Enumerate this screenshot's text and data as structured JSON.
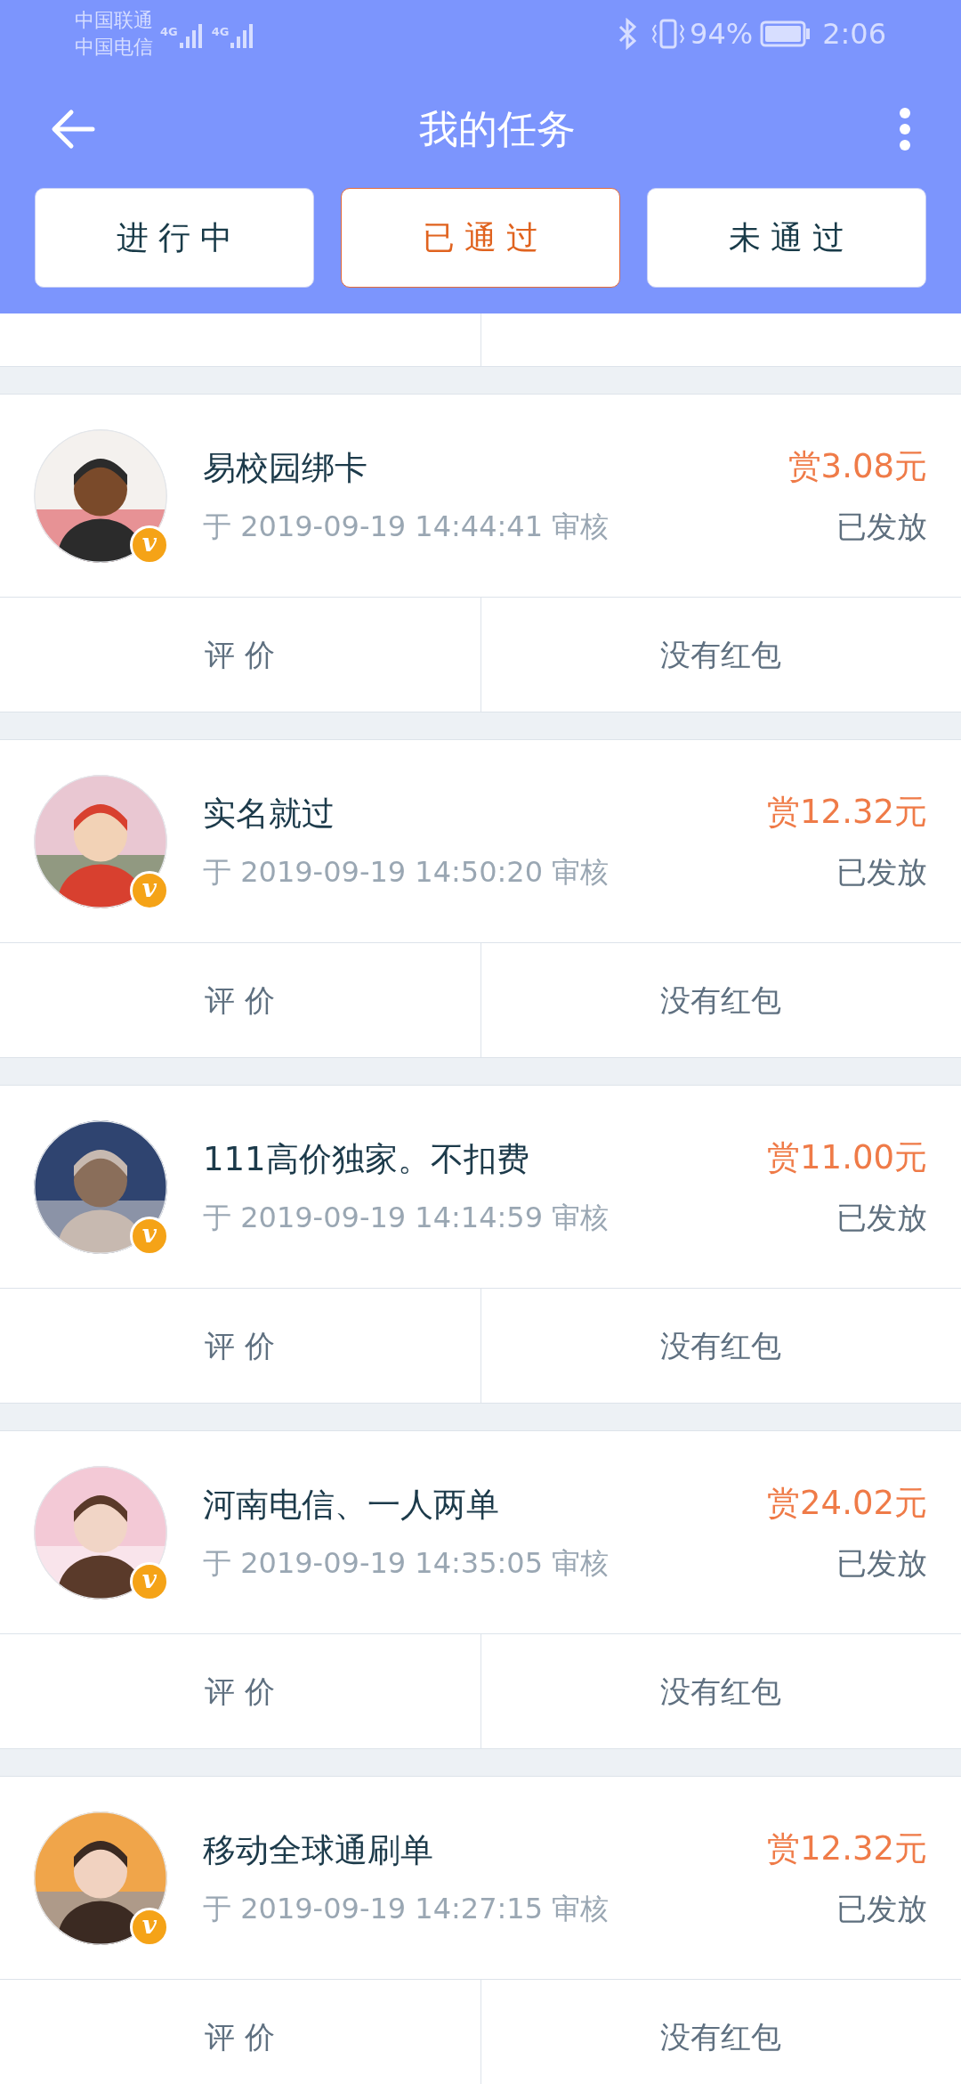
{
  "status_bar": {
    "carriers": [
      {
        "name": "中国联通",
        "network": "4G"
      },
      {
        "name": "中国电信",
        "network": "4G"
      }
    ],
    "battery": "94%",
    "time": "2:06"
  },
  "header": {
    "title": "我的任务"
  },
  "tabs": [
    {
      "label": "进 行 中",
      "selected": false
    },
    {
      "label": "已 通 过",
      "selected": true
    },
    {
      "label": "未 通 过",
      "selected": false
    }
  ],
  "tasks": [
    {
      "title": "易校园绑卡",
      "date": "于 2019-09-19 14:44:41 审核",
      "reward": "赏3.08元",
      "status": "已发放",
      "badge": "v",
      "rate": "评 价",
      "bonus": "没有红包"
    },
    {
      "title": "实名就过",
      "date": "于 2019-09-19 14:50:20 审核",
      "reward": "赏12.32元",
      "status": "已发放",
      "badge": "v",
      "rate": "评 价",
      "bonus": "没有红包"
    },
    {
      "title": "111高价独家。不扣费",
      "date": "于 2019-09-19 14:14:59 审核",
      "reward": "赏11.00元",
      "status": "已发放",
      "badge": "v",
      "rate": "评 价",
      "bonus": "没有红包"
    },
    {
      "title": "河南电信、一人两单",
      "date": "于 2019-09-19 14:35:05 审核",
      "reward": "赏24.02元",
      "status": "已发放",
      "badge": "v",
      "rate": "评 价",
      "bonus": "没有红包"
    },
    {
      "title": "移动全球通刷单",
      "date": "于 2019-09-19 14:27:15 审核",
      "reward": "赏12.32元",
      "status": "已发放",
      "badge": "v",
      "rate": "评 价",
      "bonus": "没有红包"
    }
  ]
}
